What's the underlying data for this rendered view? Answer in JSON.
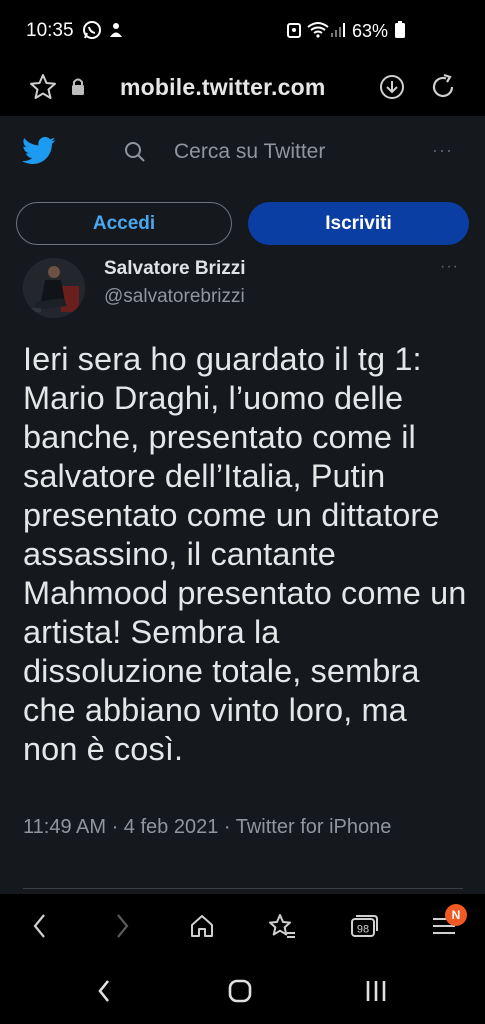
{
  "status_bar": {
    "time": "10:35",
    "battery": "63%",
    "icons": [
      "whatsapp-icon",
      "notification-icon",
      "alarm-icon",
      "wifi-icon",
      "signal-icon",
      "battery-icon"
    ]
  },
  "browser": {
    "url": "mobile.twitter.com"
  },
  "header": {
    "search_placeholder": "Cerca su Twitter",
    "more": "···"
  },
  "auth": {
    "login_label": "Accedi",
    "signup_label": "Iscriviti"
  },
  "tweet": {
    "author_name": "Salvatore Brizzi",
    "author_handle": "@salvatorebrizzi",
    "more": "···",
    "text": "Ieri sera ho guardato il tg 1: Mario Draghi, l’uomo delle banche, presentato come il salvatore dell’Italia, Putin presentato come un dittatore assassino, il cantante Mahmood presentato come un artista! Sembra la dissoluzione totale, sembra che abbiano vinto loro, ma non è così.",
    "meta": "11:49 AM · 4 feb 2021 · Twitter for iPhone"
  },
  "toolbar": {
    "tabs_count": "98",
    "notification_badge": "N"
  },
  "colors": {
    "page_bg": "#15181c",
    "accent": "#1d9bf0",
    "signup_bg": "#0a3ea3",
    "badge": "#f05a22"
  }
}
